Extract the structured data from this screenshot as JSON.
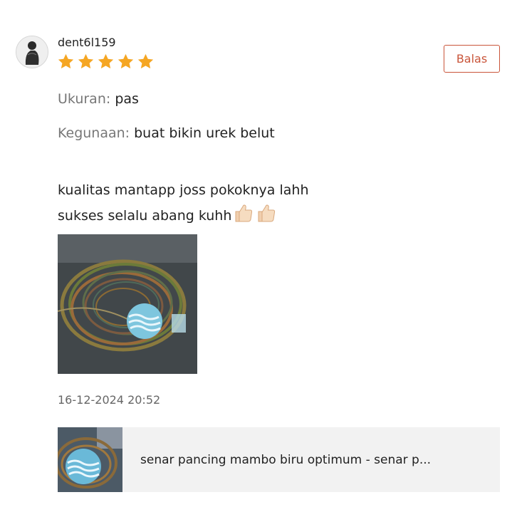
{
  "review": {
    "username": "dent6l159",
    "rating": 5,
    "rating_max": 5,
    "star_color": "#f5a623",
    "reply_label": "Balas",
    "attributes": [
      {
        "label": "Ukuran:",
        "value": "pas"
      },
      {
        "label": "Kegunaan:",
        "value": "buat bikin urek belut"
      }
    ],
    "text_lines": [
      "kualitas mantapp joss pokoknya lahh",
      "sukses selalu abang kuhh"
    ],
    "emoji": [
      "thumbs-up",
      "thumbs-up"
    ],
    "timestamp": "16-12-2024 20:52"
  },
  "product": {
    "title": "senar pancing mambo biru optimum - senar p..."
  },
  "colors": {
    "accent": "#c9553a",
    "card_background": "#f2f2f2"
  }
}
